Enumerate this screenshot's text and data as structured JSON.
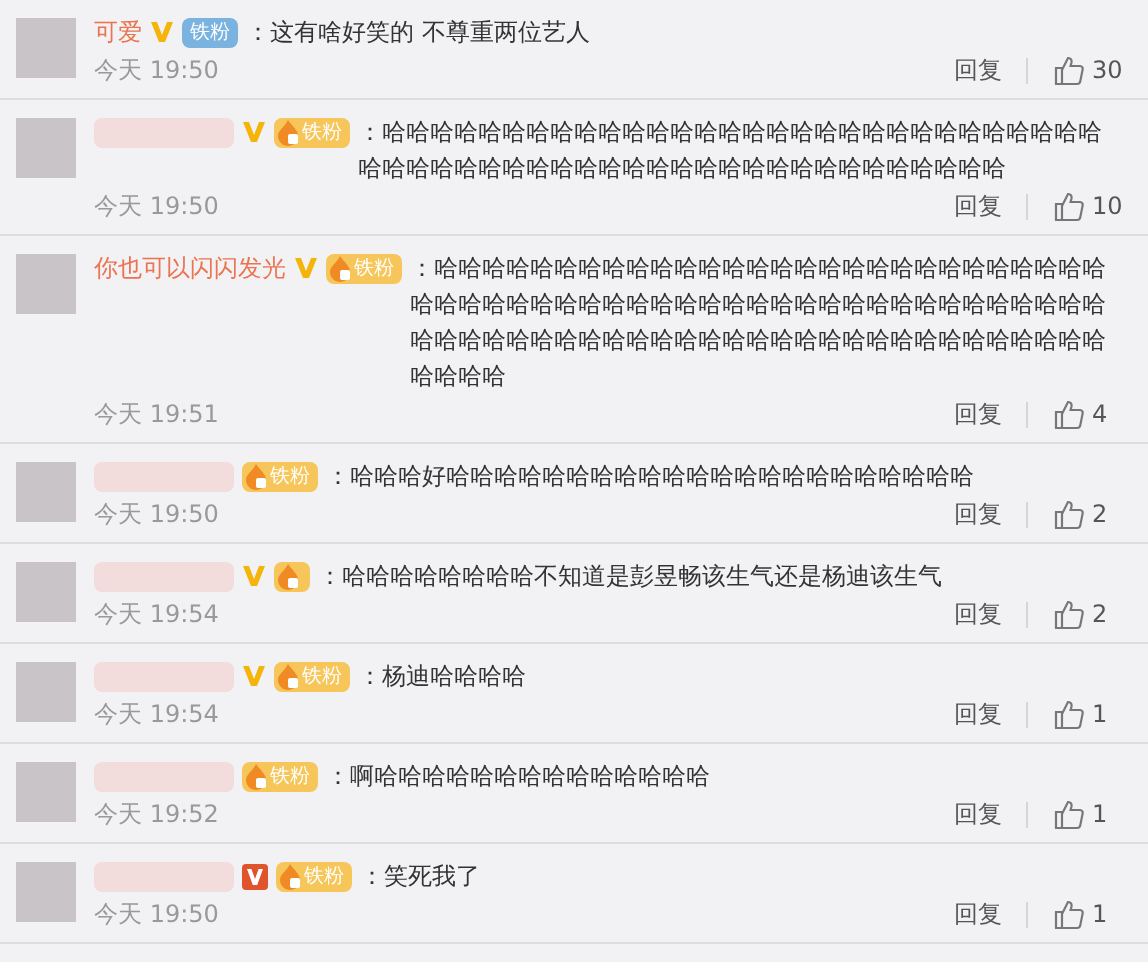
{
  "comments": [
    {
      "name": "可爱",
      "verified_badge": {
        "kind": "plain",
        "color": "#f5b40a"
      },
      "badge": {
        "kind": "blue",
        "label": "铁粉"
      },
      "text": "：这有啥好笑的 不尊重两位艺人",
      "time": "今天 19:50",
      "reply": "回复",
      "likes": "30"
    },
    {
      "verified_badge": {
        "kind": "plain",
        "color": "#f5b40a"
      },
      "badge": {
        "kind": "orange",
        "label": "铁粉"
      },
      "text": "：哈哈哈哈哈哈哈哈哈哈哈哈哈哈哈哈哈哈哈哈哈哈哈哈哈哈哈哈哈哈哈哈哈哈哈哈哈哈哈哈哈哈哈哈哈哈哈哈哈哈哈哈哈哈哈哈哈",
      "time": "今天 19:50",
      "reply": "回复",
      "likes": "10"
    },
    {
      "name": "你也可以闪闪发光",
      "verified_badge": {
        "kind": "plain",
        "color": "#f5b40a"
      },
      "badge": {
        "kind": "orange",
        "label": "铁粉"
      },
      "text": "：哈哈哈哈哈哈哈哈哈哈哈哈哈哈哈哈哈哈哈哈哈哈哈哈哈哈哈哈哈哈哈哈哈哈哈哈哈哈哈哈哈哈哈哈哈哈哈哈哈哈哈哈哈哈哈哈哈哈哈哈哈哈哈哈哈哈哈哈哈哈哈哈哈哈哈哈哈哈哈哈哈哈哈哈哈哈哈哈哈哈",
      "time": "今天 19:51",
      "reply": "回复",
      "likes": "4"
    },
    {
      "badge": {
        "kind": "orange",
        "label": "铁粉"
      },
      "text": "：哈哈哈好哈哈哈哈哈哈哈哈哈哈哈哈哈哈哈哈哈哈哈哈哈哈",
      "time": "今天 19:50",
      "reply": "回复",
      "likes": "2"
    },
    {
      "verified_badge": {
        "kind": "plain",
        "color": "#f5b40a"
      },
      "badge": {
        "kind": "orange"
      },
      "text": "：哈哈哈哈哈哈哈哈不知道是彭昱畅该生气还是杨迪该生气",
      "time": "今天 19:54",
      "reply": "回复",
      "likes": "2"
    },
    {
      "verified_badge": {
        "kind": "plain",
        "color": "#f5b40a"
      },
      "badge": {
        "kind": "orange",
        "label": "铁粉"
      },
      "text": "：杨迪哈哈哈哈",
      "time": "今天 19:54",
      "reply": "回复",
      "likes": "1"
    },
    {
      "badge": {
        "kind": "orange",
        "label": "铁粉"
      },
      "text": "：啊哈哈哈哈哈哈哈哈哈哈哈哈哈哈",
      "time": "今天 19:52",
      "reply": "回复",
      "likes": "1"
    },
    {
      "verified_badge": {
        "kind": "boxed",
        "color": "#e0542b"
      },
      "badge": {
        "kind": "orange",
        "label": "铁粉"
      },
      "text": "：笑死我了",
      "time": "今天 19:50",
      "reply": "回复",
      "likes": "1"
    }
  ]
}
